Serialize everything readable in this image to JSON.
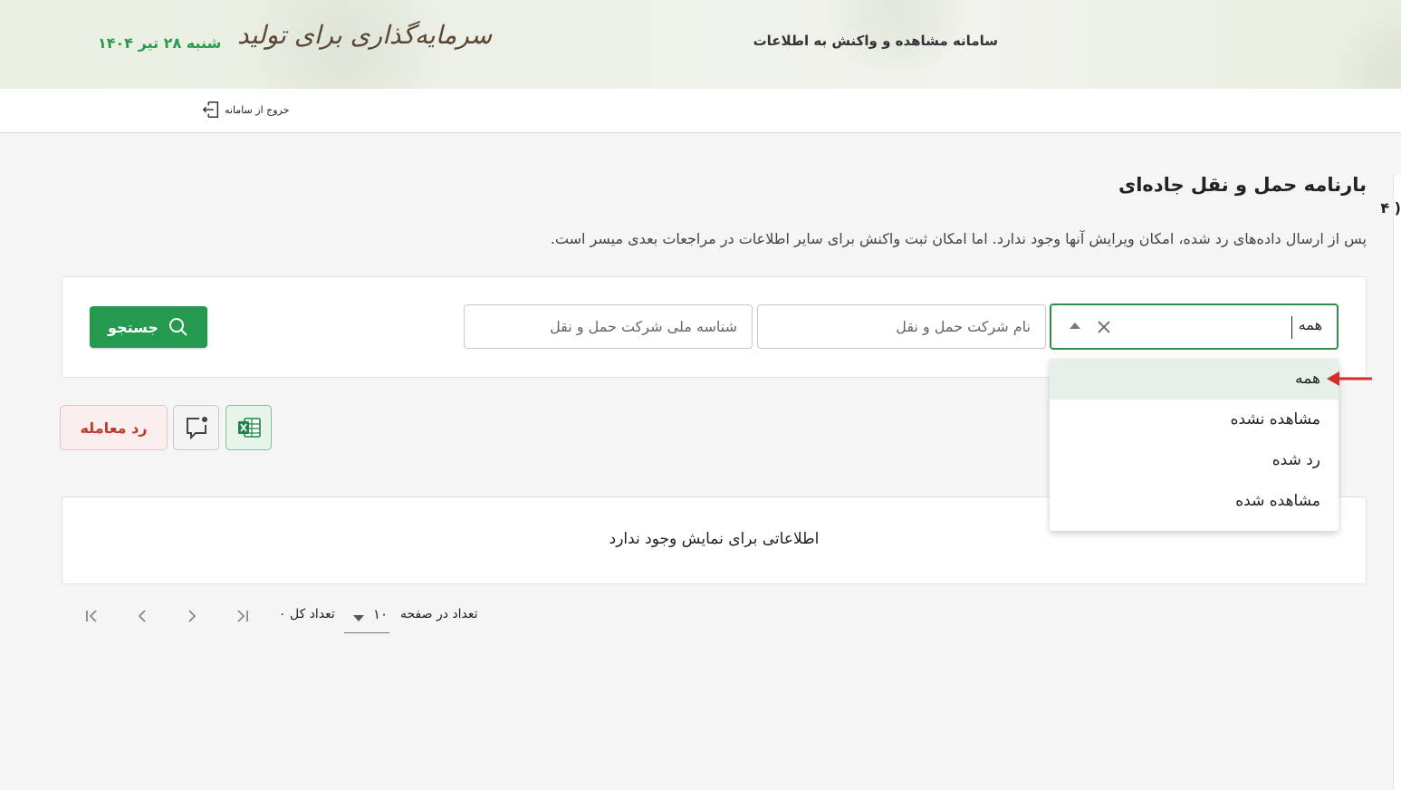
{
  "header": {
    "app_title": "سامانه مشاهده و واکنش به اطلاعات",
    "logo_text": "سرمایه‌گذاری برای تولید",
    "date": "شنبه ۲۸ تیر ۱۴۰۴"
  },
  "topbar": {
    "logout_label": "خروج از سامانه"
  },
  "right_peek": "۴ )",
  "page": {
    "title": "بارنامه حمل و نقل جاده‌ای",
    "description": "پس از ارسال داده‌های رد شده، امکان ویرایش آنها وجود ندارد. اما امکان ثبت واکنش برای سایر اطلاعات در مراجعات بعدی میسر است."
  },
  "filters": {
    "status_value": "همه",
    "company_name_placeholder": "نام شرکت حمل و نقل",
    "company_id_placeholder": "شناسه ملی شرکت حمل و نقل",
    "search_label": "جستجو"
  },
  "dropdown": {
    "options": [
      "همه",
      "مشاهده نشده",
      "رد شده",
      "مشاهده شده"
    ]
  },
  "actions": {
    "reject_label": "رد معامله"
  },
  "results": {
    "empty_message": "اطلاعاتی برای نمایش وجود ندارد"
  },
  "pagination": {
    "per_page_label": "تعداد در صفحه",
    "per_page_value": "۱۰",
    "total_label": "تعداد کل ۰"
  },
  "colors": {
    "primary_green": "#239a4e",
    "date_green": "#2a9b4a",
    "reject_red": "#c0392b",
    "pointer_red": "#d32f2f"
  }
}
